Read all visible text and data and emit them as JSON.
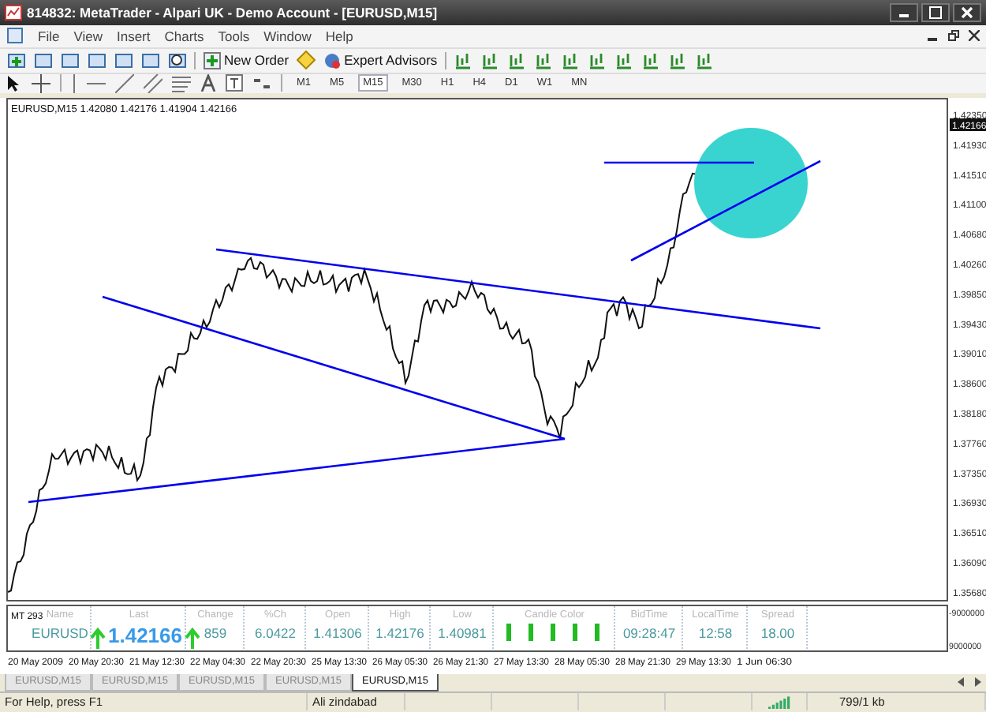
{
  "window": {
    "title": "814832: MetaTrader - Alpari UK - Demo Account - [EURUSD,M15]"
  },
  "menu": [
    "File",
    "View",
    "Insert",
    "Charts",
    "Tools",
    "Window",
    "Help"
  ],
  "toolbar": {
    "buttons": [
      "New Order",
      "Expert Advisors"
    ]
  },
  "timeframes": [
    {
      "label": "M1",
      "selected": false
    },
    {
      "label": "M5",
      "selected": false
    },
    {
      "label": "M15",
      "selected": true
    },
    {
      "label": "M30",
      "selected": false
    },
    {
      "label": "H1",
      "selected": false
    },
    {
      "label": "H4",
      "selected": false
    },
    {
      "label": "D1",
      "selected": false
    },
    {
      "label": "W1",
      "selected": false
    },
    {
      "label": "MN",
      "selected": false
    }
  ],
  "chart": {
    "header": "EURUSD,M15  1.42080 1.42176 1.41904 1.42166",
    "price_axis": [
      "1.42350",
      "1.41930",
      "1.41510",
      "1.41100",
      "1.40680",
      "1.40260",
      "1.39850",
      "1.39430",
      "1.39010",
      "1.38600",
      "1.38180",
      "1.37760",
      "1.37350",
      "1.36930",
      "1.36510",
      "1.36090",
      "1.35680"
    ],
    "current_price": "1.42166",
    "time_axis": [
      "20 May 2009",
      "20 May 20:30",
      "21 May 12:30",
      "22 May 04:30",
      "22 May 20:30",
      "25 May 13:30",
      "26 May 05:30",
      "26 May 21:30",
      "27 May 13:30",
      "28 May 05:30",
      "28 May 21:30",
      "29 May 13:30",
      "1 Jun 06:30"
    ]
  },
  "indicator": {
    "label": "MT 293",
    "scale": [
      "-9000000",
      "9000000"
    ],
    "columns": [
      {
        "heading": "Name",
        "value": "EURUSD",
        "kind": "text"
      },
      {
        "heading": "Last",
        "value": "1.42166",
        "kind": "big",
        "arrow": true
      },
      {
        "heading": "Change",
        "value": "859",
        "kind": "text",
        "arrow": true
      },
      {
        "heading": "%Ch",
        "value": "6.0422",
        "kind": "text"
      },
      {
        "heading": "Open",
        "value": "1.41306",
        "kind": "text"
      },
      {
        "heading": "High",
        "value": "1.42176",
        "kind": "text"
      },
      {
        "heading": "Low",
        "value": "1.40981",
        "kind": "text"
      },
      {
        "heading": "Candle Color",
        "kind": "bars",
        "candles": [
          {
            "color": "#22bb22"
          },
          {
            "color": "#22bb22"
          },
          {
            "color": "#22bb22"
          },
          {
            "color": "#22bb22"
          },
          {
            "color": "#22bb22"
          }
        ]
      },
      {
        "heading": "BidTime",
        "value": "09:28:47",
        "kind": "text"
      },
      {
        "heading": "LocalTime",
        "value": "12:58",
        "kind": "text"
      },
      {
        "heading": "Spread",
        "value": "18.00",
        "kind": "text"
      }
    ]
  },
  "tabs": [
    {
      "label": "EURUSD,M15",
      "selected": false
    },
    {
      "label": "EURUSD,M15",
      "selected": false
    },
    {
      "label": "EURUSD,M15",
      "selected": false
    },
    {
      "label": "EURUSD,M15",
      "selected": false
    },
    {
      "label": "EURUSD,M15",
      "selected": true
    }
  ],
  "status_bar": {
    "help": "For Help, press F1",
    "text": "Ali zindabad",
    "traffic": "799/1 kb"
  }
}
